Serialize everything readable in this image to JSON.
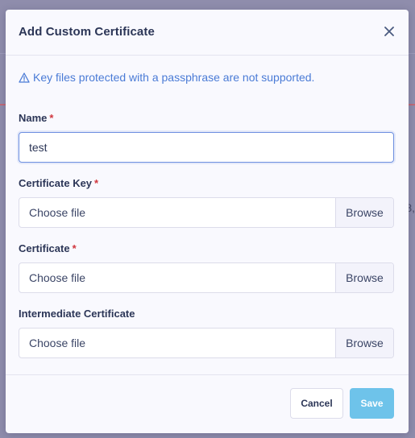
{
  "modal": {
    "title": "Add Custom Certificate",
    "warning_text": "Key files protected with a passphrase are not supported.",
    "fields": {
      "name": {
        "label": "Name",
        "required_mark": "*",
        "value": "test"
      },
      "certificate_key": {
        "label": "Certificate Key",
        "required_mark": "*",
        "placeholder": "Choose file",
        "browse_label": "Browse"
      },
      "certificate": {
        "label": "Certificate",
        "required_mark": "*",
        "placeholder": "Choose file",
        "browse_label": "Browse"
      },
      "intermediate_certificate": {
        "label": "Intermediate Certificate",
        "placeholder": "Choose file",
        "browse_label": "Browse"
      }
    },
    "footer": {
      "cancel_label": "Cancel",
      "save_label": "Save"
    }
  },
  "backdrop": {
    "fragment_right": "8,"
  },
  "colors": {
    "accent_blue": "#4a7bd6",
    "required_red": "#d0363e",
    "save_button": "#6ec3ea",
    "overlay": "#8f8dac"
  },
  "icons": {
    "close": "close-icon",
    "warning": "warning-triangle-icon"
  }
}
